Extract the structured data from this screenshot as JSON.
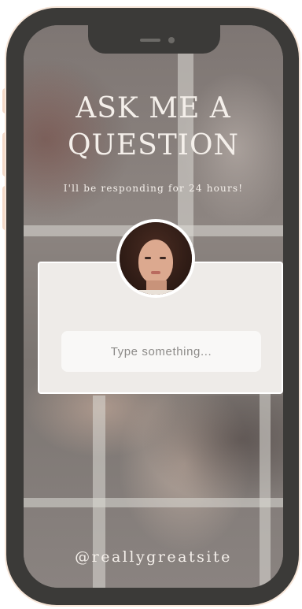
{
  "story": {
    "title_line1": "ASK ME A",
    "title_line2": "QUESTION",
    "subtitle": "I'll be responding for 24 hours!",
    "question_box": {
      "placeholder": "Type something..."
    },
    "handle": "@reallygreatsite"
  },
  "colors": {
    "phone_frame": "#3b3a38",
    "side_buttons": "#f3d9c8",
    "card_background": "#eeebe8",
    "text_light": "#f4efea"
  },
  "icons": {
    "avatar": "profile-photo"
  }
}
